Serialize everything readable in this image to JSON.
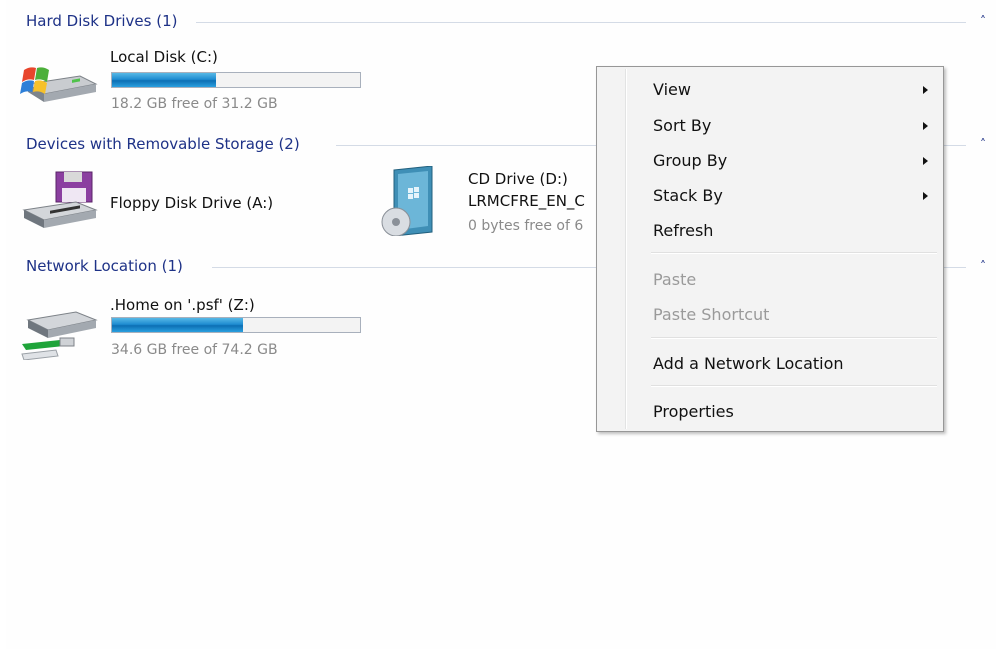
{
  "groups": [
    {
      "title": "Hard Disk Drives (1)",
      "collapse_glyph": "˄"
    },
    {
      "title": "Devices with Removable Storage (2)",
      "collapse_glyph": "˄"
    },
    {
      "title": "Network Location (1)",
      "collapse_glyph": "˄"
    }
  ],
  "drives": {
    "local_c": {
      "name": "Local Disk (C:)",
      "free_text": "18.2 GB free of 31.2 GB",
      "used_fraction": 0.42
    },
    "floppy_a": {
      "name": "Floppy Disk Drive (A:)"
    },
    "cd_d": {
      "name": "CD Drive (D:)",
      "label": "LRMCFRE_EN_C",
      "free_text": "0 bytes free of 6"
    },
    "net_z": {
      "name": ".Home on '.psf' (Z:)",
      "free_text": "34.6 GB free of 74.2 GB",
      "used_fraction": 0.53
    }
  },
  "context_menu": {
    "view": "View",
    "sort_by": "Sort By",
    "group_by": "Group By",
    "stack_by": "Stack By",
    "refresh": "Refresh",
    "paste": "Paste",
    "paste_shortcut": "Paste Shortcut",
    "add_network_location": "Add a Network Location",
    "properties": "Properties"
  },
  "colors": {
    "group_title": "#1e3287",
    "bar_fill": "#1f8cd1",
    "disabled_text": "#9a9a9a"
  }
}
